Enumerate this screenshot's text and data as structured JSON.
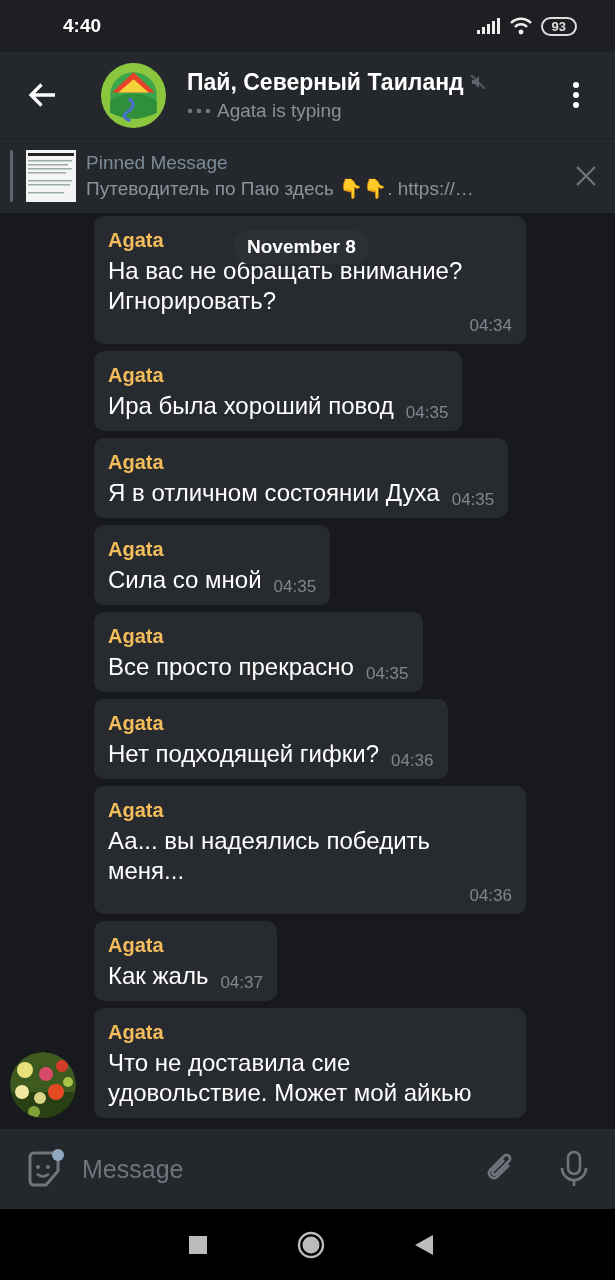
{
  "status_bar": {
    "time": "4:40",
    "battery": "93"
  },
  "header": {
    "title": "Пай, Северный Таиланд",
    "muted": true,
    "status": "Agata is typing"
  },
  "pinned": {
    "label": "Pinned Message",
    "text": "Путеводитель по Паю здесь 👇👇.  https://…"
  },
  "date_badge": "November 8",
  "messages": [
    {
      "sender": "Agata",
      "text": "На вас не обращать внимание? Игнорировать?",
      "time": "04:34"
    },
    {
      "sender": "Agata",
      "text": "Ира была хороший повод",
      "time": "04:35"
    },
    {
      "sender": "Agata",
      "text": "Я в отличном состоянии Духа",
      "time": "04:35"
    },
    {
      "sender": "Agata",
      "text": "Сила со мной",
      "time": "04:35"
    },
    {
      "sender": "Agata",
      "text": "Все просто прекрасно",
      "time": "04:35"
    },
    {
      "sender": "Agata",
      "text": "Нет подходящей гифки?",
      "time": "04:36"
    },
    {
      "sender": "Agata",
      "text": "Аа... вы надеялись победить меня...",
      "time": "04:36"
    },
    {
      "sender": "Agata",
      "text": "Как жаль",
      "time": "04:37"
    },
    {
      "sender": "Agata",
      "text": "Что не доставила сие удовольствие. Может мой айкью"
    }
  ],
  "composer": {
    "placeholder": "Message"
  }
}
